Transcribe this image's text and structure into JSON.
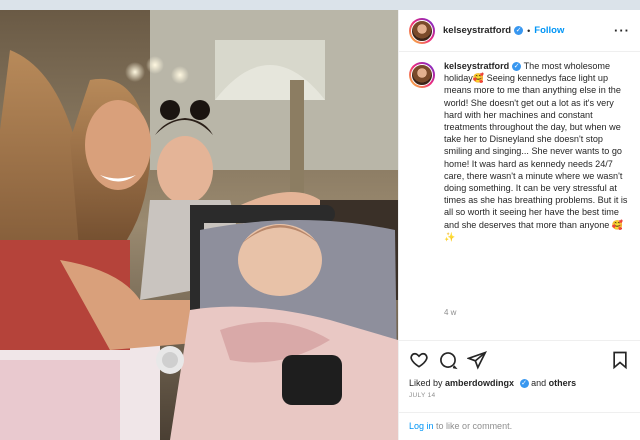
{
  "post": {
    "username": "kelseystratford",
    "follow_label": "Follow",
    "caption_username": "kelseystratford",
    "caption_text": "The most wholesome holiday🥰 Seeing kennedys face light up means more to me than anything else in the world! She doesn't get out a lot as it's very hard with her machines and constant treatments throughout the day, but when we take her to Disneyland she doesn't stop smiling and singing... She never wants to go home! It was hard as kennedy needs 24/7 care, there wasn't a minute where we wasn't doing something. It can be very stressful at times as she has breathing problems. But it is all so worth it seeing her have the best time and she deserves that more than anyone 🥰 ✨",
    "time_ago": "4 w",
    "liked_by_prefix": "Liked by",
    "liked_by_user": "amberdowdingx",
    "liked_by_suffix": "and",
    "liked_by_others": "others",
    "date": "JULY 14",
    "login_link": "Log in",
    "login_suffix": "to like or comment."
  },
  "icons": [
    "more-options-icon",
    "heart-icon",
    "comment-icon",
    "share-icon",
    "bookmark-icon",
    "verified-icon"
  ],
  "colors": {
    "link_blue": "#0095f6",
    "verified_blue": "#3897f0",
    "muted": "#8e8e8e",
    "text": "#262626"
  }
}
